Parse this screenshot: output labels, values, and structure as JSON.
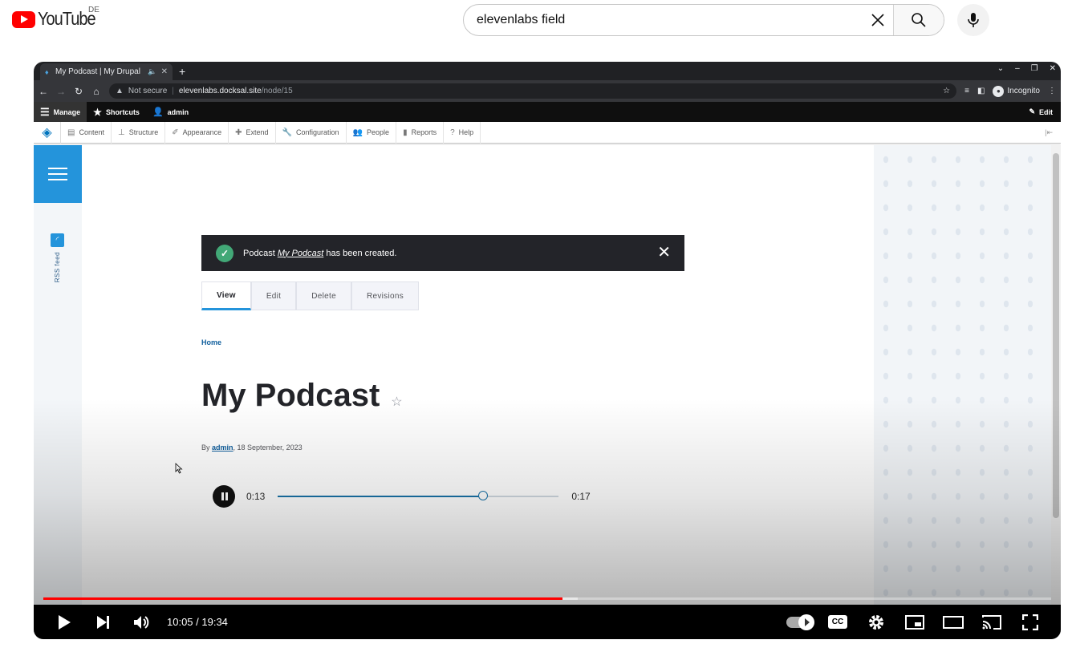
{
  "youtube": {
    "logo_text": "YouTube",
    "country_code": "DE",
    "search": {
      "value": "elevenlabs field"
    }
  },
  "browser": {
    "tab_title": "My Podcast | My Drupal",
    "url_warning": "Not secure",
    "url_host": "elevenlabs.docksal.site",
    "url_path": "/node/15",
    "incognito_label": "Incognito"
  },
  "drupal": {
    "toolbar": {
      "manage": "Manage",
      "shortcuts": "Shortcuts",
      "user": "admin",
      "edit": "Edit"
    },
    "menu": [
      {
        "label": "Content",
        "icon": "content-icon"
      },
      {
        "label": "Structure",
        "icon": "structure-icon"
      },
      {
        "label": "Appearance",
        "icon": "appearance-icon"
      },
      {
        "label": "Extend",
        "icon": "extend-icon"
      },
      {
        "label": "Configuration",
        "icon": "configuration-icon"
      },
      {
        "label": "People",
        "icon": "people-icon"
      },
      {
        "label": "Reports",
        "icon": "reports-icon"
      },
      {
        "label": "Help",
        "icon": "help-icon"
      }
    ],
    "rss_label": "RSS feed",
    "message": {
      "prefix": "Podcast ",
      "link": "My Podcast",
      "suffix": " has been created."
    },
    "tabs": [
      "View",
      "Edit",
      "Delete",
      "Revisions"
    ],
    "breadcrumb": "Home",
    "title": "My Podcast",
    "byline": {
      "prefix": "By ",
      "author": "admin",
      "date": ", 18 September, 2023"
    },
    "audio": {
      "current": "0:13",
      "duration": "0:17",
      "progress": 0.73
    }
  },
  "player": {
    "time": "10:05 / 19:34",
    "played_fraction": 0.515,
    "buffered_fraction": 0.53,
    "cc_label": "CC"
  },
  "colors": {
    "youtube_red": "#ff0000",
    "drupal_blue": "#2494db",
    "message_bg": "#232429"
  }
}
